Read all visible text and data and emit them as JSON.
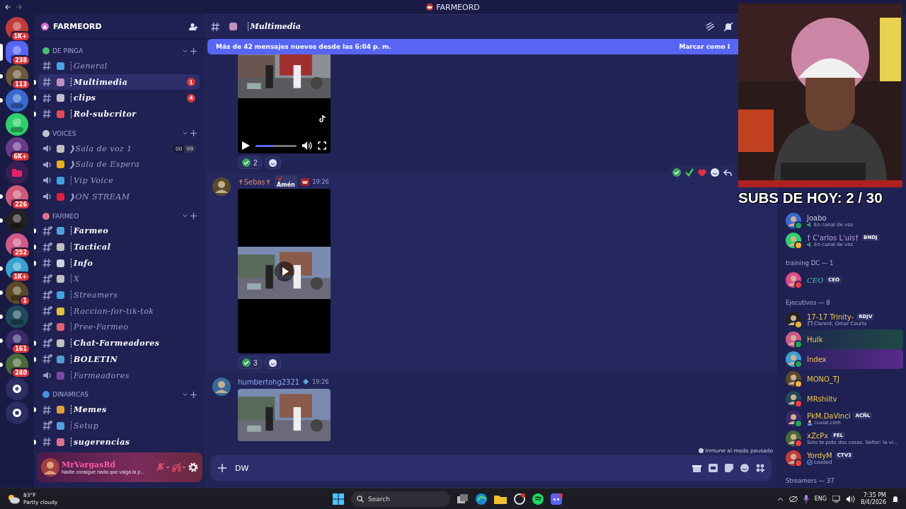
{
  "window": {
    "title": "FARMEORD"
  },
  "servers": [
    {
      "kind": "server",
      "badge": "1K+",
      "selected": false,
      "unread": false
    },
    {
      "kind": "server",
      "badge": "238",
      "selected": true,
      "unread": false
    },
    {
      "kind": "server",
      "badge": "113",
      "selected": false,
      "unread": true
    },
    {
      "kind": "server",
      "selected": false,
      "unread": true
    },
    {
      "kind": "server",
      "selected": false,
      "unread": false
    },
    {
      "kind": "server",
      "badge": "6K+",
      "selected": false,
      "unread": false
    },
    {
      "kind": "folder",
      "selected": false,
      "unread": false
    },
    {
      "kind": "server",
      "badge": "226",
      "selected": false,
      "unread": true
    },
    {
      "kind": "server",
      "selected": false,
      "unread": true
    },
    {
      "kind": "server",
      "badge": "252",
      "selected": false,
      "unread": false
    },
    {
      "kind": "server",
      "badge": "1K+",
      "selected": false,
      "unread": true
    },
    {
      "kind": "server",
      "badge": "1",
      "selected": false,
      "unread": true
    },
    {
      "kind": "server",
      "selected": false,
      "unread": true
    },
    {
      "kind": "server",
      "badge": "161",
      "selected": false,
      "unread": true
    },
    {
      "kind": "server",
      "badge": "240",
      "selected": false,
      "unread": true
    },
    {
      "kind": "add",
      "selected": false,
      "unread": false
    },
    {
      "kind": "discover",
      "selected": false,
      "unread": false
    }
  ],
  "sidebar": {
    "server_name": "FARMEORD",
    "categories": [
      {
        "name": "DE PINGA",
        "channels": [
          {
            "kind": "text",
            "name": "┊General",
            "unread": false,
            "selected": false
          },
          {
            "kind": "text",
            "name": "┊Multimedia",
            "unread": true,
            "selected": true,
            "badge": "1"
          },
          {
            "kind": "text",
            "name": "┊clips",
            "unread": true,
            "selected": false,
            "badge": "4"
          },
          {
            "kind": "text",
            "name": "┊Rol-subcritor",
            "unread": true,
            "selected": false
          }
        ]
      },
      {
        "name": "VOICES",
        "channels": [
          {
            "kind": "voice",
            "name": "❱Sala de voz 1",
            "unread": false,
            "selected": false,
            "limit": [
              "00",
              "99"
            ]
          },
          {
            "kind": "voice",
            "name": "❱Sala de Espera",
            "unread": false,
            "selected": false
          },
          {
            "kind": "voice",
            "name": "┊Vip Voice",
            "unread": false,
            "selected": false
          },
          {
            "kind": "voice",
            "name": "❱ON STREAM",
            "unread": false,
            "selected": false
          }
        ]
      },
      {
        "name": "FARMEO",
        "channels": [
          {
            "kind": "special",
            "name": "┊Farmeo",
            "unread": true,
            "selected": false
          },
          {
            "kind": "special",
            "name": "┊Tactical",
            "unread": true,
            "selected": false
          },
          {
            "kind": "text",
            "name": "┊Info",
            "unread": true,
            "selected": false
          },
          {
            "kind": "special",
            "name": "┊X",
            "unread": false,
            "selected": false
          },
          {
            "kind": "special",
            "name": "┊Streamers",
            "unread": false,
            "selected": false
          },
          {
            "kind": "special",
            "name": "┊Raccion-for-tik-tok",
            "unread": false,
            "selected": false
          },
          {
            "kind": "special",
            "name": "┊Pree-Farmeo",
            "unread": false,
            "selected": false
          },
          {
            "kind": "special",
            "name": "┊Chat-Farmeadores",
            "unread": true,
            "selected": false
          },
          {
            "kind": "special",
            "name": "┊BOLETIN",
            "unread": true,
            "selected": false
          },
          {
            "kind": "voice",
            "name": "┊Farmeadores",
            "unread": false,
            "selected": false
          }
        ]
      },
      {
        "name": "DINAMICAS",
        "channels": [
          {
            "kind": "text",
            "name": "┊Memes",
            "unread": true,
            "selected": false
          },
          {
            "kind": "special",
            "name": "┊Setup",
            "unread": false,
            "selected": false
          },
          {
            "kind": "text",
            "name": "┊sugerencias",
            "unread": true,
            "selected": false
          }
        ]
      }
    ],
    "user": {
      "name": "MrVargasRd",
      "status": "Nadie consigue nada que valga la p..."
    }
  },
  "chat": {
    "channel": "┊Multimedia",
    "banner": {
      "text": "Más de 42 mensajes nuevos desde las 6:04 p. m.",
      "action": "Marcar como l"
    },
    "messages": [
      {
        "kind": "video",
        "controls": true,
        "hover": false,
        "level": 0.45,
        "reactions": [
          {
            "count": "2"
          }
        ]
      },
      {
        "kind": "video",
        "author": {
          "text": "✝Sebas✝",
          "color": "#d98a6e"
        },
        "tag": "Amén",
        "time": "19:26",
        "controls": false,
        "hover": true,
        "reactions": [
          {
            "count": "3"
          }
        ]
      },
      {
        "author": {
          "text": "humbertohg2321",
          "color": "#8eaaf5"
        },
        "time": "19:26",
        "hover": false
      }
    ],
    "notice": "Inmune al modo pausado",
    "composer": {
      "value": "DW"
    }
  },
  "members": [
    {
      "kind": "member",
      "name": {
        "text": "Joabo",
        "color": "#c9cbe8"
      },
      "color": "#23a55a",
      "activity": {
        "kind": "voice",
        "text": "En canal de voz"
      }
    },
    {
      "kind": "member",
      "name": {
        "text": "† C'arlos L'uis†",
        "color": "#b7a2e8"
      },
      "color": "#f0b232",
      "tag": "BNDJ",
      "activity": {
        "kind": "voice",
        "text": "En canal de voz"
      }
    },
    {
      "kind": "group",
      "name": "training DC — 1"
    },
    {
      "kind": "member",
      "name": {
        "text": "CEO",
        "color": "#3fc4b4"
      },
      "color": "#f23f43",
      "tag": "CEO"
    },
    {
      "kind": "group",
      "name": "Ejecutivos — 8"
    },
    {
      "kind": "member",
      "name": {
        "text": "17-17 Trinity-",
        "color": "#f2c94c"
      },
      "color": "#f0b232",
      "tag": "RDJV",
      "activity": {
        "kind": "music",
        "text": "Clarent, Omar Courtz"
      }
    },
    {
      "kind": "member",
      "name": {
        "text": "Hulk",
        "color": "#f2c94c"
      },
      "color": "#23a55a",
      "plate": {
        "color": "#1f4a45"
      }
    },
    {
      "kind": "member",
      "name": {
        "text": "Index",
        "color": "#f2c94c"
      },
      "color": "#23a55a",
      "plate": {
        "color": "#5a2a8c"
      }
    },
    {
      "kind": "member",
      "name": {
        "text": "MONO_TJ",
        "color": "#f2c94c"
      },
      "color": "#f0b232"
    },
    {
      "kind": "member",
      "name": {
        "text": "MRshiitv",
        "color": "#f2c94c"
      },
      "color": "#f23f43"
    },
    {
      "kind": "member",
      "name": {
        "text": "PkM.DaVinci",
        "color": "#f2c94c"
      },
      "color": "#23a55a",
      "tag": "ACÑL",
      "activity": {
        "kind": "person",
        "text": "cuxial.com"
      }
    },
    {
      "kind": "member",
      "name": {
        "text": "xZcPx",
        "color": "#f2c94c"
      },
      "color": "#f23f43",
      "tag": "FEL",
      "activity": {
        "kind": "plain",
        "text": "Solo te pido dos cosas, Señor: la vi..."
      }
    },
    {
      "kind": "member",
      "name": {
        "text": "YordyM",
        "color": "#f2c94c"
      },
      "color": "#f23f43",
      "tag": "CTV3",
      "activity": {
        "kind": "check",
        "text": "Loaded"
      }
    },
    {
      "kind": "group",
      "name": "Streamers — 37"
    }
  ],
  "overlay": {
    "subs": "SUBS DE HOY: 2 / 30"
  },
  "taskbar": {
    "temperature": "83°F",
    "weather": "Partly cloudy",
    "search": "Search",
    "language": "ENG",
    "time": "7:35 PM",
    "date": "8/4/2026"
  }
}
